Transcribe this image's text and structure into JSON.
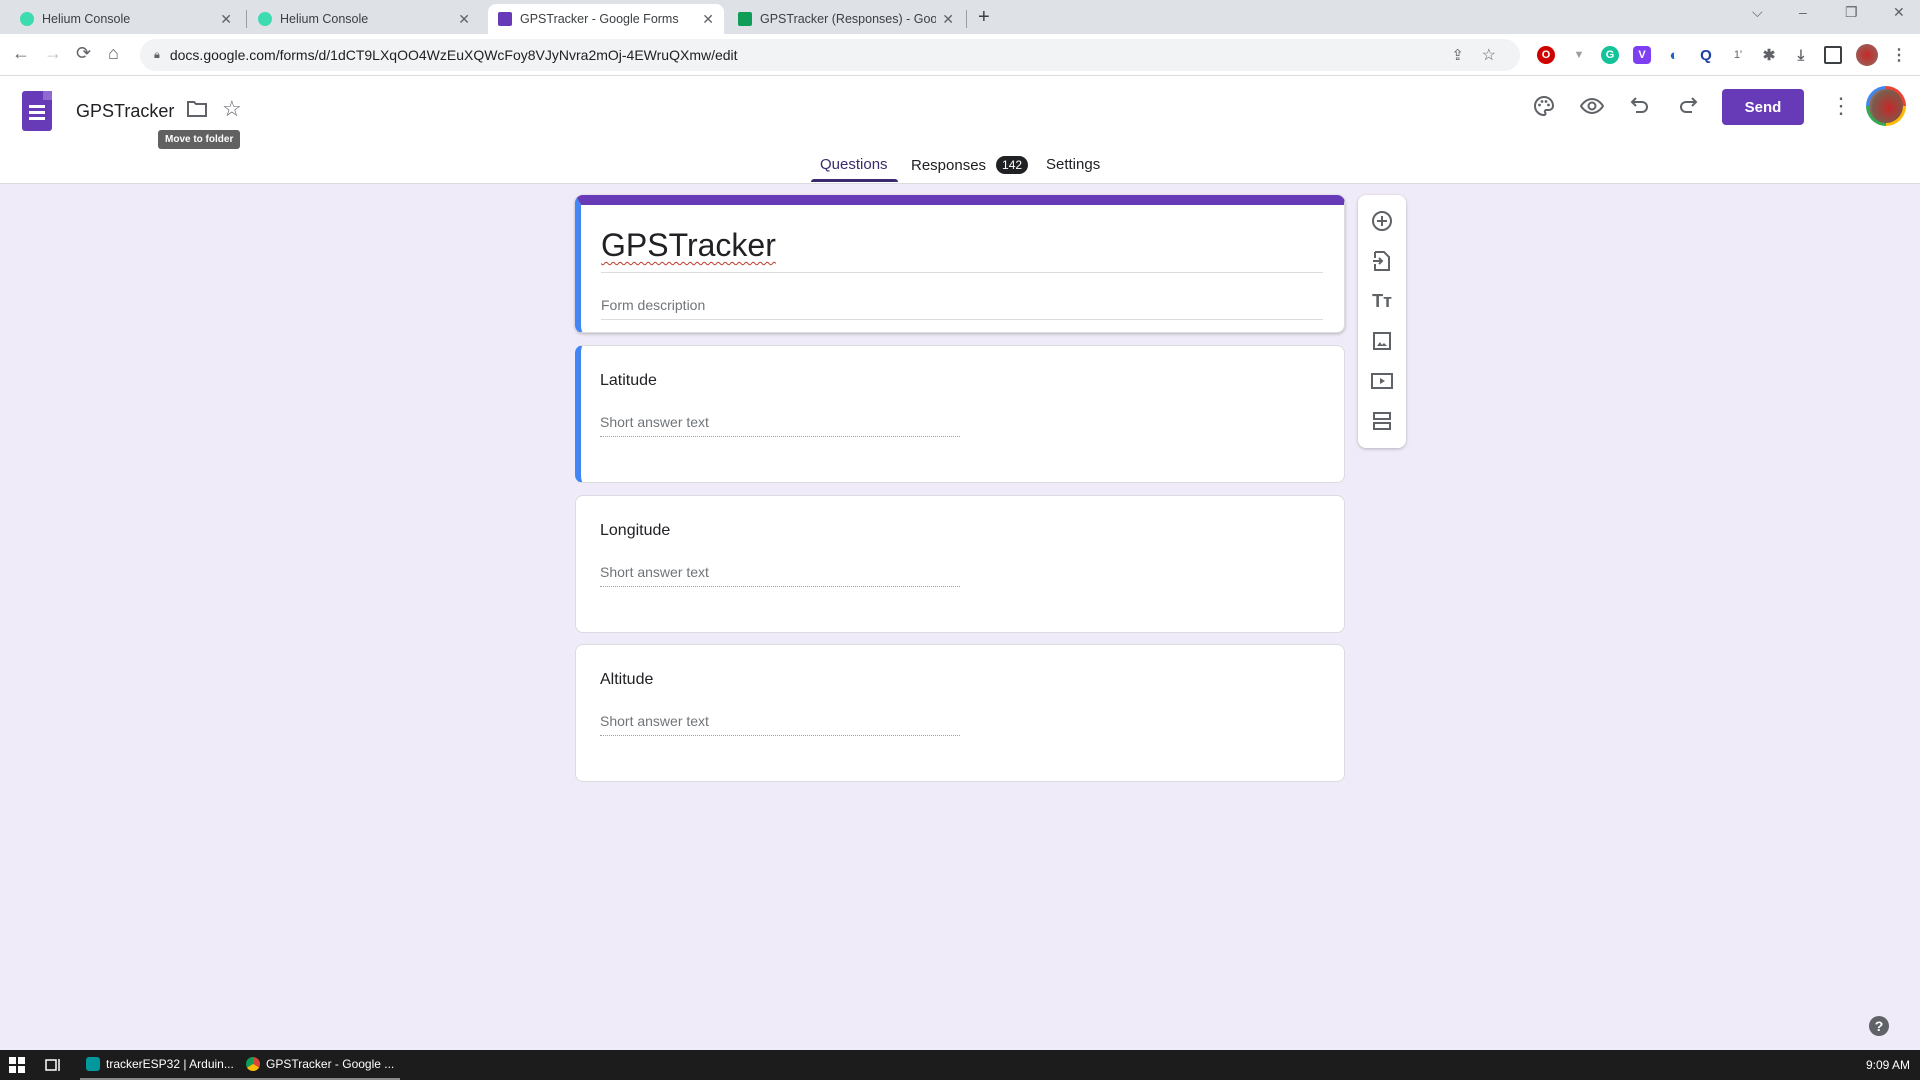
{
  "browser": {
    "tabs": [
      {
        "title": "Helium Console",
        "icon": "helium-icon",
        "color": "#3ddbb0",
        "active": false
      },
      {
        "title": "Helium Console",
        "icon": "helium-icon",
        "color": "#3ddbb0",
        "active": false
      },
      {
        "title": "GPSTracker - Google Forms",
        "icon": "google-forms-icon",
        "color": "#673ab7",
        "active": true
      },
      {
        "title": "GPSTracker (Responses) - Googl",
        "icon": "google-sheets-icon",
        "color": "#0f9d58",
        "active": false
      }
    ],
    "close_glyph": "✕",
    "new_tab_glyph": "+",
    "url": "docs.google.com/forms/d/1dCT9LXqOO4WzEuXQWcFoy8VJyNvra2mOj-4EWruQXmw/edit",
    "window_controls": {
      "tab_search": "⌵",
      "minimize": "–",
      "restore": "❐",
      "close": "✕"
    },
    "nav": {
      "back": "←",
      "forward": "→",
      "reload": "⟳",
      "home": "⌂"
    },
    "extensions": [
      {
        "name": "opera-extension",
        "glyph": "O",
        "color": "#d00000"
      },
      {
        "name": "vue-devtools-extension",
        "glyph": "▼",
        "color": "#9e9e9e"
      },
      {
        "name": "grammarly-extension",
        "glyph": "G",
        "color": "#15c39a"
      },
      {
        "name": "v-extension",
        "glyph": "V",
        "color": "#7e3ff2"
      },
      {
        "name": "privacy-extension",
        "glyph": "◐",
        "color": "#1565c0"
      },
      {
        "name": "search-extension",
        "glyph": "Q",
        "color": "#1a3fa6"
      },
      {
        "name": "counter-extension",
        "glyph": "1'",
        "color": "#5f6368"
      }
    ]
  },
  "forms_header": {
    "doc_title": "GPSTracker",
    "tooltip": "Move to folder",
    "send_label": "Send",
    "tabs": [
      {
        "label": "Questions",
        "active": true
      },
      {
        "label": "Responses",
        "badge": "142",
        "active": false
      },
      {
        "label": "Settings",
        "active": false
      }
    ]
  },
  "form": {
    "title": "GPSTracker",
    "description_placeholder": "Form description",
    "questions": [
      {
        "title": "Latitude",
        "answer_placeholder": "Short answer text",
        "selected": true
      },
      {
        "title": "Longitude",
        "answer_placeholder": "Short answer text",
        "selected": false
      },
      {
        "title": "Altitude",
        "answer_placeholder": "Short answer text",
        "selected": false
      }
    ]
  },
  "sidebar_tools": [
    "add-question",
    "import-questions",
    "add-title-description",
    "add-image",
    "add-video",
    "add-section"
  ],
  "help_glyph": "?",
  "taskbar": {
    "apps": [
      {
        "label": "trackerESP32 | Arduin...",
        "color": "#00979d"
      },
      {
        "label": "GPSTracker - Google ...",
        "color": "#db4437"
      }
    ],
    "clock": "9:09 AM"
  }
}
